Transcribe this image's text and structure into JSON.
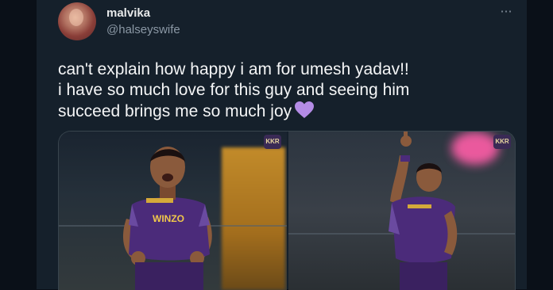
{
  "tweet": {
    "author_name": "malvika",
    "author_handle": "@halseyswife",
    "more_icon": "⋯",
    "text_line1": "can't explain how happy i am for umesh yadav!!",
    "text_line2": "i have so much love for this guy and seeing him",
    "text_line3": "succeed brings me so much joy",
    "emoji": "purple-heart"
  },
  "media": {
    "left_jersey_text": "WINZO",
    "logo_text": "KKR"
  },
  "colors": {
    "background": "#15202b",
    "text": "#f4f5f6",
    "secondary_text": "#8b98a5",
    "heart": "#b48ce6",
    "jersey": "#4b2b7a"
  }
}
